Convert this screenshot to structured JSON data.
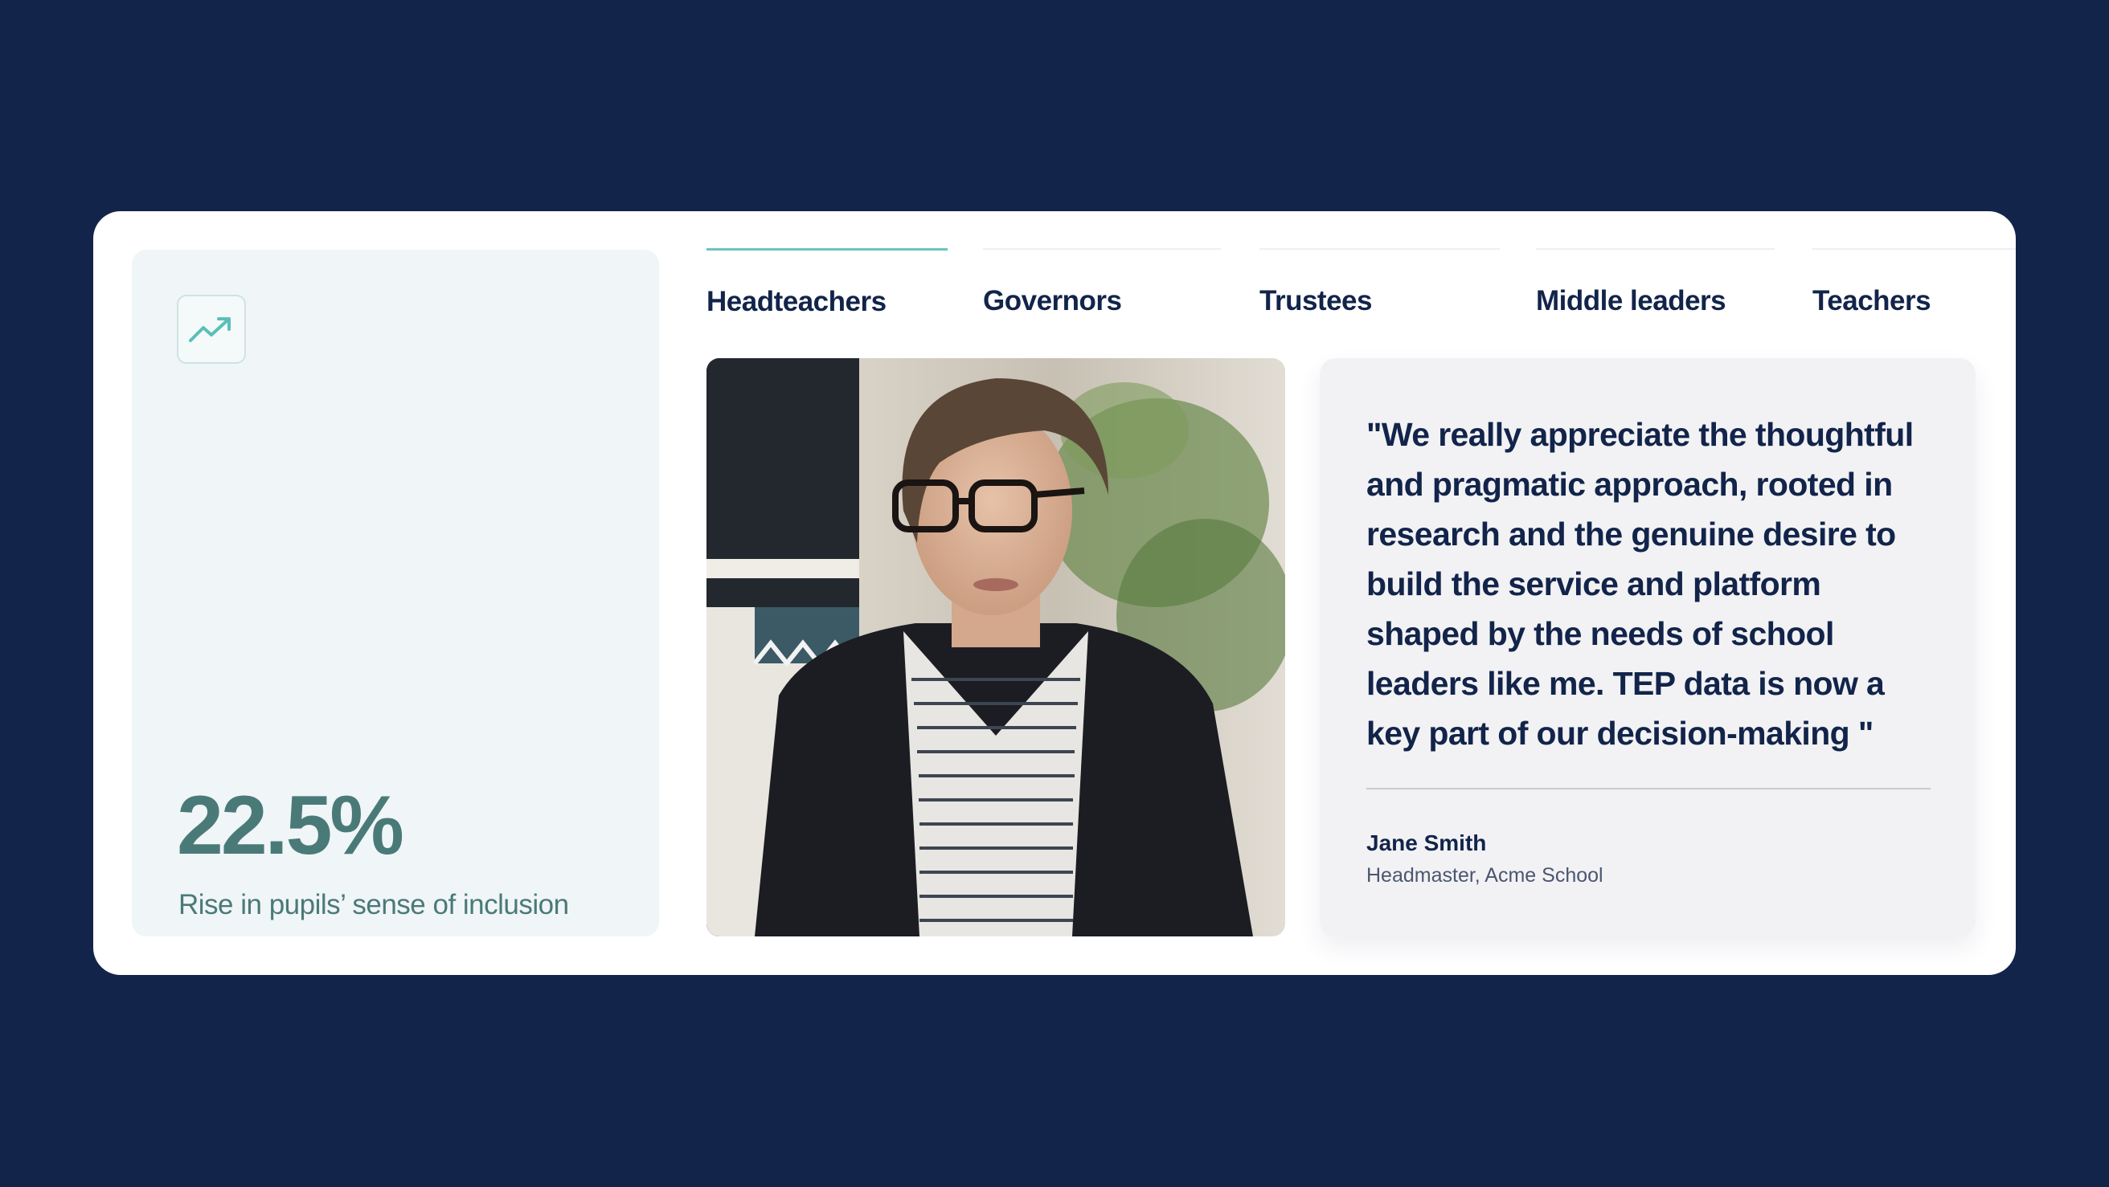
{
  "stat": {
    "icon": "trending-up-icon",
    "value": "22.5%",
    "label": "Rise in pupils’ sense of inclusion"
  },
  "tabs": [
    {
      "label": "Headteachers",
      "active": true
    },
    {
      "label": "Governors",
      "active": false
    },
    {
      "label": "Trustees",
      "active": false
    },
    {
      "label": "Middle leaders",
      "active": false
    },
    {
      "label": "Teachers",
      "active": false
    }
  ],
  "testimonial": {
    "quote": "\"We really appreciate the thoughtful and pragmatic approach, rooted in research and the genuine desire to build the service and platform shaped by the needs of school leaders like me. TEP data is now a key part of our decision-making \"",
    "author_name": "Jane Smith",
    "author_role": "Headmaster, Acme School"
  },
  "colors": {
    "background": "#12244a",
    "accent_teal": "#6cc4c0",
    "stat_text": "#4a7a78",
    "heading_text": "#12244a"
  }
}
